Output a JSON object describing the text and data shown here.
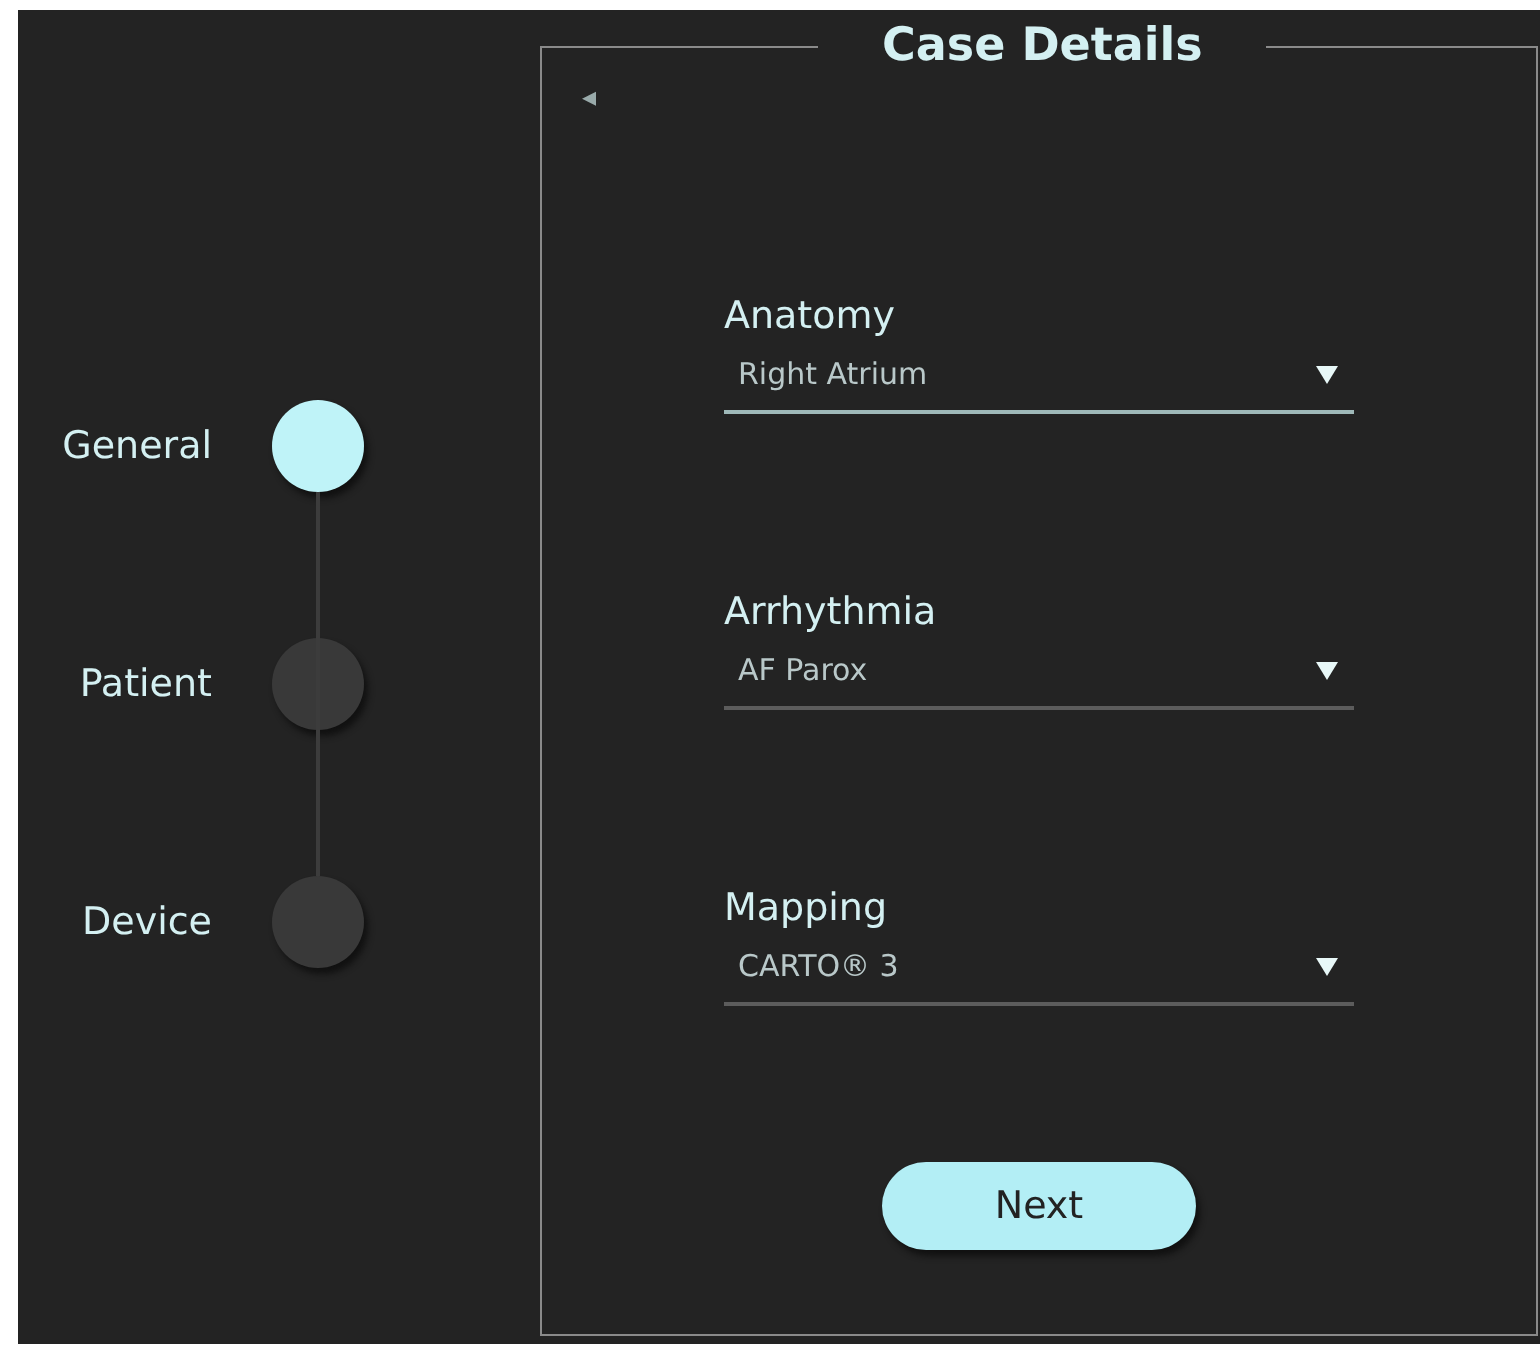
{
  "stepper": [
    {
      "label": "General",
      "selected": true
    },
    {
      "label": "Patient",
      "selected": false
    },
    {
      "label": "Device",
      "selected": false
    }
  ],
  "panel": {
    "title": "Case Details",
    "back": "◂"
  },
  "fields": [
    {
      "label": "Anatomy",
      "value": "Right Atrium",
      "focused": true
    },
    {
      "label": "Arrhythmia",
      "value": "AF Parox",
      "focused": false
    },
    {
      "label": "Mapping",
      "value": "CARTO® 3",
      "focused": false
    }
  ],
  "next_button": "Next"
}
